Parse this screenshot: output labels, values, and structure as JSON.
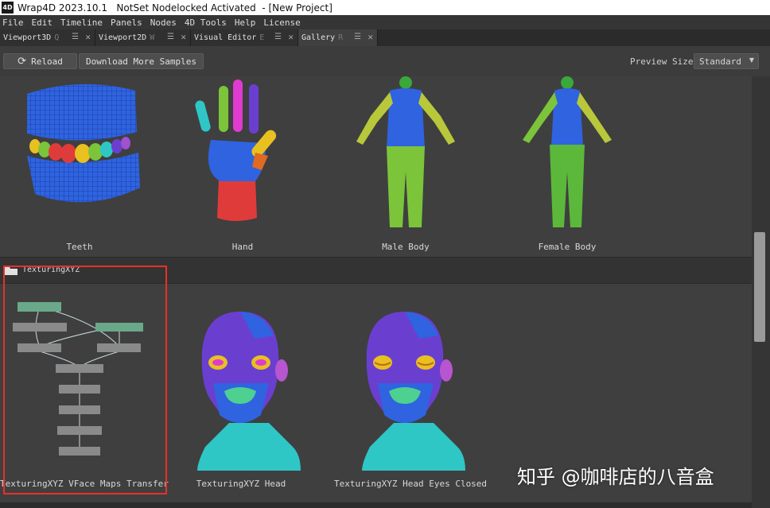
{
  "window": {
    "logo": "4D",
    "title": "Wrap4D 2023.10.1   NotSet Nodelocked Activated  - [New Project]"
  },
  "menu": [
    "File",
    "Edit",
    "Timeline",
    "Panels",
    "Nodes",
    "4D Tools",
    "Help",
    "License"
  ],
  "tabs": [
    {
      "label": "Viewport3D",
      "shortcut": "Q"
    },
    {
      "label": "Viewport2D",
      "shortcut": "W"
    },
    {
      "label": "Visual Editor",
      "shortcut": "E"
    },
    {
      "label": "Gallery",
      "shortcut": "R"
    }
  ],
  "toolbar": {
    "reload_label": "Reload",
    "download_label": "Download More Samples",
    "preview_size_label": "Preview Size",
    "preview_size_value": "Standard"
  },
  "gallery": {
    "row1": [
      "Teeth",
      "Hand",
      "Male Body",
      "Female Body"
    ],
    "section_name": "TexturingXYZ",
    "row2": [
      "TexturingXYZ VFace Maps Transfer",
      "TexturingXYZ Head",
      "TexturingXYZ Head Eyes Closed"
    ]
  },
  "watermark": "知乎 @咖啡店的八音盒",
  "colors": {
    "selection": "#e8302a",
    "mesh_blue": "#2f63e0",
    "mesh_purple": "#6a3fd0",
    "mesh_teal": "#2fc6c6",
    "mesh_green": "#7cc43a"
  }
}
